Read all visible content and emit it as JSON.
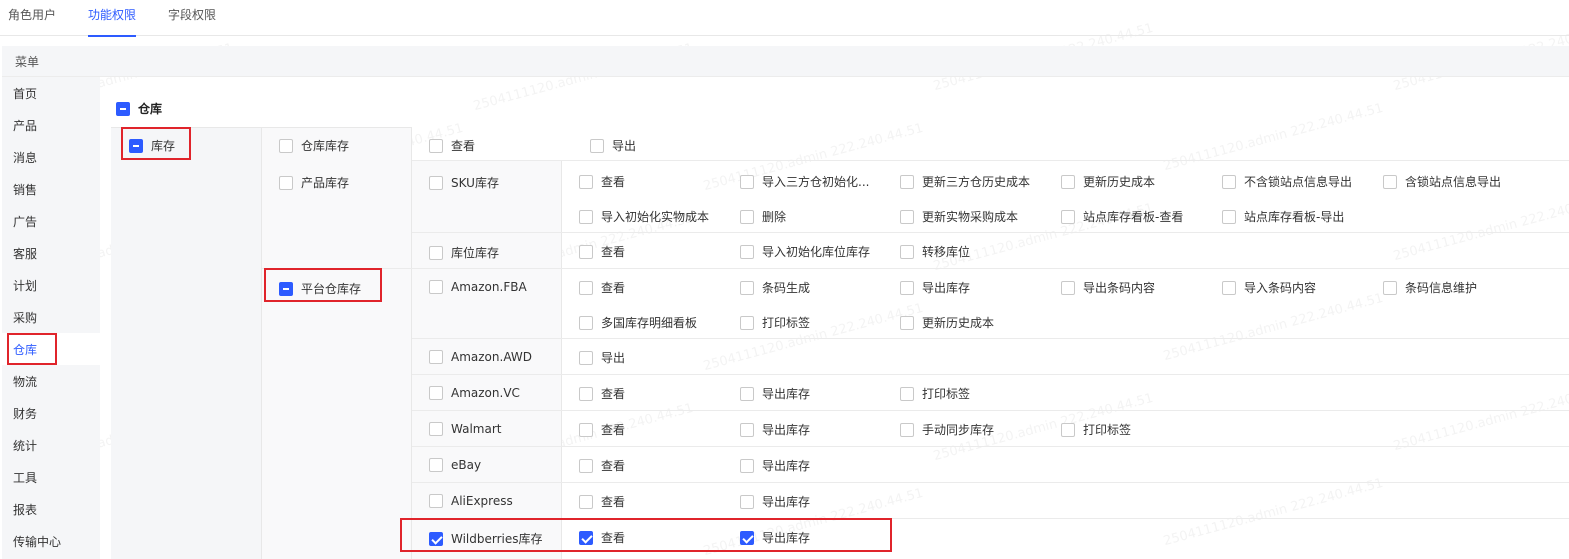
{
  "tabs": [
    "角色用户",
    "功能权限",
    "字段权限"
  ],
  "menu_header": "菜单",
  "menu": [
    "首页",
    "产品",
    "消息",
    "销售",
    "广告",
    "客服",
    "计划",
    "采购",
    "仓库",
    "物流",
    "财务",
    "统计",
    "工具",
    "报表",
    "传输中心"
  ],
  "category": "仓库",
  "module": "库存",
  "rows": {
    "warehouse_stock": {
      "label": "仓库库存",
      "perms": [
        "查看",
        "导出"
      ]
    },
    "product_stock": {
      "label": "产品库存"
    },
    "sku_stock": {
      "label": "SKU库存",
      "perms": [
        "查看",
        "导入三方仓初始化...",
        "更新三方仓历史成本",
        "更新历史成本",
        "不含锁站点信息导出",
        "含锁站点信息导出",
        "导入初始化实物成本",
        "删除",
        "更新实物采购成本",
        "站点库存看板-查看",
        "站点库存看板-导出"
      ]
    },
    "location_stock": {
      "label": "库位库存",
      "perms": [
        "查看",
        "导入初始化库位库存",
        "转移库位"
      ]
    },
    "platform_stock": {
      "label": "平台仓库存"
    },
    "amazon_fba": {
      "label": "Amazon.FBA",
      "perms": [
        "查看",
        "条码生成",
        "导出库存",
        "导出条码内容",
        "导入条码内容",
        "条码信息维护",
        "多国库存明细看板",
        "打印标签",
        "更新历史成本"
      ]
    },
    "amazon_awd": {
      "label": "Amazon.AWD",
      "perms": [
        "导出"
      ]
    },
    "amazon_vc": {
      "label": "Amazon.VC",
      "perms": [
        "查看",
        "导出库存",
        "打印标签"
      ]
    },
    "walmart": {
      "label": "Walmart",
      "perms": [
        "查看",
        "导出库存",
        "手动同步库存",
        "打印标签"
      ]
    },
    "ebay": {
      "label": "eBay",
      "perms": [
        "查看",
        "导出库存"
      ]
    },
    "aliexpress": {
      "label": "AliExpress",
      "perms": [
        "查看",
        "导出库存"
      ]
    },
    "wildberries": {
      "label": "Wildberries库存",
      "perms": [
        "查看",
        "导出库存"
      ]
    }
  },
  "watermark": "2504111120.admin 222.240.44.51",
  "colors": {
    "accent": "#2d5bff",
    "highlight": "#e0242b",
    "panel": "#f5f6f8"
  }
}
